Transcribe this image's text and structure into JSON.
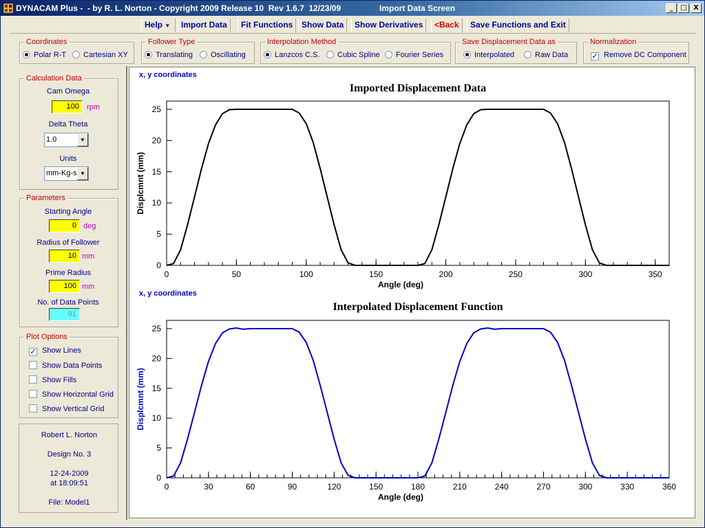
{
  "window": {
    "title": "DYNACAM Plus -  - by R. L. Norton - Copyright 2009 Release 10  Rev 1.6.7  12/23/09",
    "screen_title": "Import Data Screen",
    "minimize": "_",
    "maximize": "□",
    "close": "X"
  },
  "menu": {
    "help": "Help",
    "import_data": "Import Data",
    "fit_functions": "Fit Functions",
    "show_data": "Show Data",
    "show_derivatives": "Show Derivatives",
    "back": "<Back",
    "save_exit": "Save Functions and Exit"
  },
  "options": {
    "coordinates": {
      "legend": "Coordinates",
      "opt1": "Polar R-T",
      "opt2": "Cartesian XY",
      "selected": "Polar R-T"
    },
    "follower_type": {
      "legend": "Follower Type",
      "opt1": "Translating",
      "opt2": "Oscillating",
      "selected": "Translating"
    },
    "interpolation": {
      "legend": "Interpolation Method",
      "opt1": "Lanzcos C.S.",
      "opt2": "Cubic Spline",
      "opt3": "Fourier Series",
      "selected": "Lanzcos C.S."
    },
    "save_as": {
      "legend": "Save Displacement Data as",
      "opt1": "Interpolated",
      "opt2": "Raw Data",
      "selected": "Interpolated"
    },
    "normalization": {
      "legend": "Normalization",
      "opt1": "Remove DC Component",
      "checked": true
    }
  },
  "calc": {
    "legend": "Calculation Data",
    "cam_omega_label": "Cam Omega",
    "cam_omega": "100",
    "cam_omega_unit": "rpm",
    "delta_theta_label": "Delta Theta",
    "delta_theta": "1.0",
    "units_label": "Units",
    "units": "mm-Kg-s"
  },
  "params": {
    "legend": "Parameters",
    "start_angle_label": "Starting Angle",
    "start_angle": "0",
    "start_angle_unit": "deg",
    "radius_follower_label": "Radius of Follower",
    "radius_follower": "10",
    "radius_follower_unit": "mm",
    "prime_radius_label": "Prime Radius",
    "prime_radius": "100",
    "prime_radius_unit": "mm",
    "num_points_label": "No. of Data Points",
    "num_points": "91"
  },
  "plot_options": {
    "legend": "Plot Options",
    "show_lines": "Show Lines",
    "show_points": "Show Data Points",
    "show_fills": "Show Fills",
    "show_hgrid": "Show Horizontal Grid",
    "show_vgrid": "Show Vertical Grid",
    "checked": [
      "Show Lines"
    ]
  },
  "info": {
    "author": "Robert L. Norton",
    "design": "Design No. 3",
    "date": "12-24-2009",
    "time": "at 18:09:51",
    "file": "File: Model1"
  },
  "colors": {
    "accent_red": "#c00000",
    "label_blue": "#00008b",
    "input_yellow": "#ffff00",
    "input_cyan": "#66ffff",
    "series_top": "#000000",
    "series_bottom": "#0000cc"
  },
  "chart_data": [
    {
      "type": "line",
      "corner_label": "x, y  coordinates",
      "title": "Imported Displacement Data",
      "xlabel": "Angle (deg)",
      "ylabel": "Displcmnt  (mm)",
      "xlim": [
        0,
        360
      ],
      "ylim": [
        0,
        25
      ],
      "xticks": [
        0,
        50,
        100,
        150,
        200,
        250,
        300,
        350
      ],
      "yticks": [
        0,
        5,
        10,
        15,
        20,
        25
      ],
      "series": [
        {
          "color": "#000000",
          "x": [
            0,
            5,
            10,
            15,
            20,
            25,
            30,
            35,
            40,
            45,
            50,
            55,
            60,
            70,
            80,
            90,
            95,
            100,
            105,
            110,
            115,
            120,
            125,
            130,
            135,
            140,
            145,
            150,
            160,
            170,
            180,
            185,
            190,
            195,
            200,
            205,
            210,
            215,
            220,
            225,
            230,
            235,
            240,
            250,
            260,
            270,
            275,
            280,
            285,
            290,
            295,
            300,
            305,
            310,
            315,
            320,
            325,
            330,
            340,
            350,
            360
          ],
          "y": [
            0,
            0.3,
            2.5,
            6.5,
            11,
            15.5,
            19.5,
            22.5,
            24.3,
            24.95,
            25,
            25,
            25,
            25,
            25,
            25,
            24.4,
            22.7,
            19.7,
            15.5,
            11,
            6.5,
            2.5,
            0.4,
            0,
            0,
            0,
            0,
            0,
            0,
            0,
            0.3,
            2.5,
            6.5,
            11,
            15.5,
            19.5,
            22.5,
            24.3,
            24.95,
            25,
            25,
            25,
            25,
            25,
            25,
            24.4,
            22.7,
            19.7,
            15.5,
            11,
            6.5,
            2.5,
            0.4,
            0,
            0,
            0,
            0,
            0,
            0,
            0
          ]
        }
      ]
    },
    {
      "type": "line",
      "corner_label": "x, y  coordinates",
      "title": "Interpolated Displacement Function",
      "xlabel": "Angle (deg)",
      "ylabel": "Displcmnt  (mm)",
      "xlim": [
        0,
        360
      ],
      "ylim": [
        0,
        25
      ],
      "xticks": [
        0,
        30,
        60,
        90,
        120,
        150,
        180,
        210,
        240,
        270,
        300,
        330,
        360
      ],
      "yticks": [
        0,
        5,
        10,
        15,
        20,
        25
      ],
      "series": [
        {
          "color": "#0000cc",
          "x": [
            0,
            5,
            10,
            15,
            20,
            25,
            30,
            35,
            40,
            45,
            50,
            55,
            60,
            70,
            80,
            90,
            95,
            100,
            105,
            110,
            115,
            120,
            125,
            130,
            135,
            140,
            145,
            150,
            160,
            170,
            180,
            185,
            190,
            195,
            200,
            205,
            210,
            215,
            220,
            225,
            230,
            235,
            240,
            250,
            260,
            270,
            275,
            280,
            285,
            290,
            295,
            300,
            305,
            310,
            315,
            320,
            325,
            330,
            340,
            350,
            360
          ],
          "y": [
            0,
            0.3,
            2.5,
            6.5,
            11,
            15.5,
            19.5,
            22.5,
            24.3,
            24.95,
            25.1,
            24.9,
            25,
            25,
            25,
            25,
            24.4,
            22.7,
            19.7,
            15.5,
            11,
            6.5,
            2.5,
            0.4,
            0,
            0,
            0,
            0,
            0,
            0,
            0,
            0.3,
            2.5,
            6.5,
            11,
            15.5,
            19.5,
            22.5,
            24.3,
            24.95,
            25.1,
            24.9,
            25,
            25,
            25,
            25,
            24.4,
            22.7,
            19.7,
            15.5,
            11,
            6.5,
            2.5,
            0.4,
            0,
            0,
            0,
            0,
            0,
            0,
            0
          ]
        }
      ]
    }
  ]
}
